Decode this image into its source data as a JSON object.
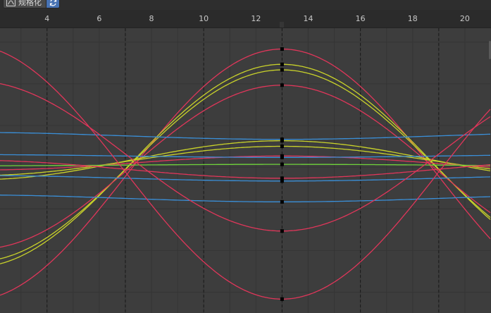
{
  "header": {
    "normalize_label": "规格化",
    "normalize_icon": "normalize-curve-icon",
    "auto_normalize_icon": "refresh-cycle-icon",
    "auto_normalize_active": true
  },
  "ruler": {
    "ticks": [
      {
        "frame": 4,
        "label": "4"
      },
      {
        "frame": 6,
        "label": "6"
      },
      {
        "frame": 8,
        "label": "8"
      },
      {
        "frame": 10,
        "label": "10"
      },
      {
        "frame": 12,
        "label": "12"
      },
      {
        "frame": 14,
        "label": "14"
      },
      {
        "frame": 16,
        "label": "16"
      },
      {
        "frame": 18,
        "label": "18"
      },
      {
        "frame": 20,
        "label": "20"
      }
    ]
  },
  "graph": {
    "frame_range": [
      2.2,
      21
    ],
    "value_range": [
      -1.05,
      1.0
    ],
    "current_frame": 13,
    "dashed_frames": [
      4,
      7,
      10,
      13,
      16,
      19
    ],
    "grid_values": [
      0.9,
      0.6,
      0.3,
      0,
      -0.3,
      -0.6,
      -0.9
    ],
    "colors": {
      "background": "#3d3d3d",
      "grid": "#353535",
      "dashed": "#1a1a1a",
      "keyframe": "#000000"
    },
    "curves": [
      {
        "name": "red-curve-1",
        "color": "#e0365a",
        "peak": 0.85,
        "trough": -0.96,
        "crossing": 7.05
      },
      {
        "name": "yellow-curve-1",
        "color": "#c9d22a",
        "peak": 0.74,
        "trough": -0.72,
        "crossing": 7.12
      },
      {
        "name": "yellow-curve-2",
        "color": "#c9d22a",
        "peak": 0.7,
        "trough": -0.68,
        "crossing": 7.15
      },
      {
        "name": "red-curve-2",
        "color": "#e0365a",
        "peak": 0.59,
        "trough": -0.59,
        "crossing": 7.2
      },
      {
        "name": "yellow-curve-3",
        "color": "#c9d22a",
        "peak": 0.19,
        "trough": -0.09,
        "crossing": 7.18
      },
      {
        "name": "yellow-curve-4",
        "color": "#c9d22a",
        "peak": 0.15,
        "trough": -0.06,
        "crossing": 7.18
      },
      {
        "name": "red-curve-3",
        "color": "#e0365a",
        "peak": 0.08,
        "trough": -0.02,
        "crossing": 7.3
      },
      {
        "name": "green-curve-1",
        "color": "#6fd23a",
        "peak": 0.02,
        "trough": 0.01,
        "crossing": 7.2
      },
      {
        "name": "red-curve-4",
        "color": "#e0365a",
        "peak": -0.08,
        "trough": 0.05,
        "crossing": 7.0
      },
      {
        "name": "blue-curve-1",
        "color": "#3a8fd8",
        "peak": 0.2,
        "trough": 0.25,
        "crossing": 7.0
      },
      {
        "name": "blue-curve-2",
        "color": "#3a8fd8",
        "peak": 0.07,
        "trough": 0.09,
        "crossing": 7.0
      },
      {
        "name": "blue-curve-3",
        "color": "#3a8fd8",
        "peak": -0.1,
        "trough": -0.06,
        "crossing": 7.0
      },
      {
        "name": "blue-curve-4",
        "color": "#3a8fd8",
        "peak": -0.25,
        "trough": -0.2,
        "crossing": 7.0
      },
      {
        "name": "red-curve-5",
        "color": "#e0365a",
        "peak": -0.46,
        "trough": 0.62,
        "crossing": 7.1
      },
      {
        "name": "red-curve-6",
        "color": "#e0365a",
        "peak": -0.95,
        "trough": 0.88,
        "crossing": 7.0
      }
    ]
  }
}
